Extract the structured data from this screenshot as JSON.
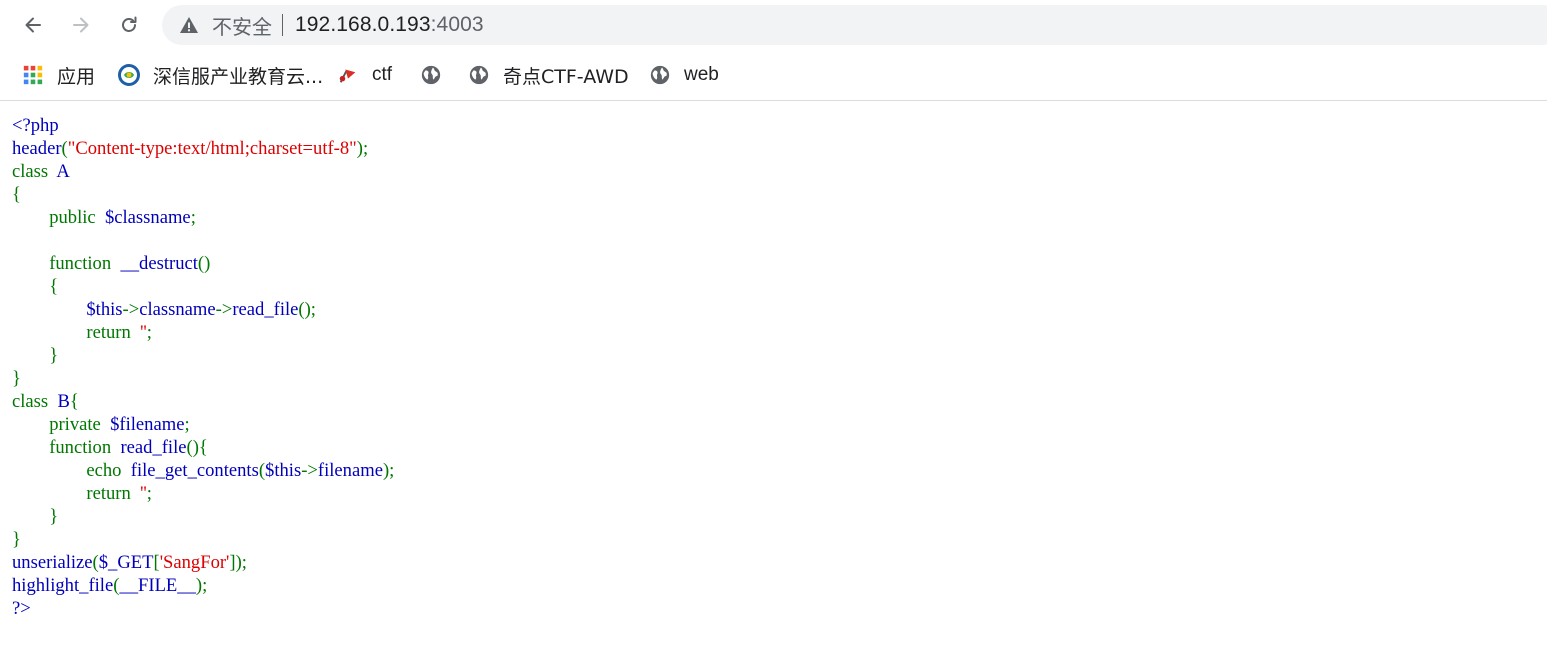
{
  "browser": {
    "url_host": "192.168.0.193",
    "url_port": ":4003",
    "security_label": "不安全"
  },
  "bookmarks": [
    {
      "label": "应用",
      "icon": "apps-grid-icon"
    },
    {
      "label": "深信服产业教育云...",
      "icon": "sangfor-logo-icon"
    },
    {
      "label": "ctf",
      "icon": "flag-icon"
    },
    {
      "label": "",
      "icon": "globe-icon"
    },
    {
      "label": "奇点CTF-AWD",
      "icon": "globe-icon"
    },
    {
      "label": "web",
      "icon": "globe-icon"
    }
  ],
  "colors": {
    "php_default": "#0000bb",
    "php_keyword": "#007700",
    "php_string": "#dd0000",
    "omnibox_bg": "#f1f3f4"
  },
  "code_lines": [
    [
      {
        "t": "<?php",
        "c": "def"
      }
    ],
    [
      {
        "t": "header",
        "c": "def"
      },
      {
        "t": "(",
        "c": "kw"
      },
      {
        "t": "\"Content-type:text/html;charset=utf-8\"",
        "c": "str"
      },
      {
        "t": ");",
        "c": "kw"
      }
    ],
    [
      {
        "t": "class  ",
        "c": "kw"
      },
      {
        "t": "A",
        "c": "def"
      }
    ],
    [
      {
        "t": "{",
        "c": "kw"
      }
    ],
    [
      {
        "t": "        public  ",
        "c": "kw"
      },
      {
        "t": "$classname",
        "c": "def"
      },
      {
        "t": ";",
        "c": "kw"
      }
    ],
    [
      {
        "t": "",
        "c": "def"
      }
    ],
    [
      {
        "t": "        function  ",
        "c": "kw"
      },
      {
        "t": "__destruct",
        "c": "def"
      },
      {
        "t": "()",
        "c": "kw"
      }
    ],
    [
      {
        "t": "        {",
        "c": "kw"
      }
    ],
    [
      {
        "t": "                ",
        "c": "kw"
      },
      {
        "t": "$this",
        "c": "def"
      },
      {
        "t": "->",
        "c": "kw"
      },
      {
        "t": "classname",
        "c": "def"
      },
      {
        "t": "->",
        "c": "kw"
      },
      {
        "t": "read_file",
        "c": "def"
      },
      {
        "t": "();",
        "c": "kw"
      }
    ],
    [
      {
        "t": "                return  ",
        "c": "kw"
      },
      {
        "t": "''",
        "c": "str"
      },
      {
        "t": ";",
        "c": "kw"
      }
    ],
    [
      {
        "t": "        }",
        "c": "kw"
      }
    ],
    [
      {
        "t": "}",
        "c": "kw"
      }
    ],
    [
      {
        "t": "class  ",
        "c": "kw"
      },
      {
        "t": "B",
        "c": "def"
      },
      {
        "t": "{",
        "c": "kw"
      }
    ],
    [
      {
        "t": "        private  ",
        "c": "kw"
      },
      {
        "t": "$filename",
        "c": "def"
      },
      {
        "t": ";",
        "c": "kw"
      }
    ],
    [
      {
        "t": "        function  ",
        "c": "kw"
      },
      {
        "t": "read_file",
        "c": "def"
      },
      {
        "t": "(){",
        "c": "kw"
      }
    ],
    [
      {
        "t": "                echo  ",
        "c": "kw"
      },
      {
        "t": "file_get_contents",
        "c": "def"
      },
      {
        "t": "(",
        "c": "kw"
      },
      {
        "t": "$this",
        "c": "def"
      },
      {
        "t": "->",
        "c": "kw"
      },
      {
        "t": "filename",
        "c": "def"
      },
      {
        "t": ");",
        "c": "kw"
      }
    ],
    [
      {
        "t": "                return  ",
        "c": "kw"
      },
      {
        "t": "''",
        "c": "str"
      },
      {
        "t": ";",
        "c": "kw"
      }
    ],
    [
      {
        "t": "        }",
        "c": "kw"
      }
    ],
    [
      {
        "t": "}",
        "c": "kw"
      }
    ],
    [
      {
        "t": "unserialize",
        "c": "def"
      },
      {
        "t": "(",
        "c": "kw"
      },
      {
        "t": "$_GET",
        "c": "def"
      },
      {
        "t": "[",
        "c": "kw"
      },
      {
        "t": "'SangFor'",
        "c": "str"
      },
      {
        "t": "]);",
        "c": "kw"
      }
    ],
    [
      {
        "t": "highlight_file",
        "c": "def"
      },
      {
        "t": "(",
        "c": "kw"
      },
      {
        "t": "__FILE__",
        "c": "def"
      },
      {
        "t": ");",
        "c": "kw"
      }
    ],
    [
      {
        "t": "?>",
        "c": "def"
      }
    ]
  ]
}
